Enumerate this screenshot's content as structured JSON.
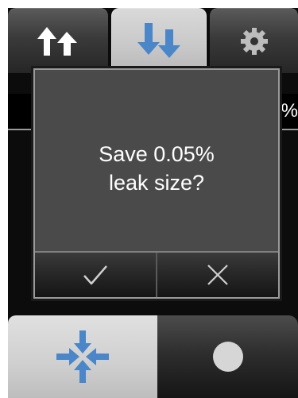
{
  "tabs": [
    {
      "icon": "sort-ascending-arrows-icon",
      "selected": false
    },
    {
      "icon": "sort-descending-arrows-icon",
      "selected": true
    },
    {
      "icon": "gear-icon",
      "selected": false
    }
  ],
  "background": {
    "partial_text": "%"
  },
  "dialog": {
    "message_line1": "Save 0.05%",
    "message_line2": "leak size?",
    "confirm_icon": "checkmark-icon",
    "cancel_icon": "close-icon"
  },
  "bottom": {
    "left_icon": "compress-arrows-icon",
    "right_icon": "record-dot-icon"
  },
  "colors": {
    "accent_blue": "#4a86c8",
    "selected_tab": "#c8c8c8",
    "dialog_bg": "#4a4a4a"
  }
}
